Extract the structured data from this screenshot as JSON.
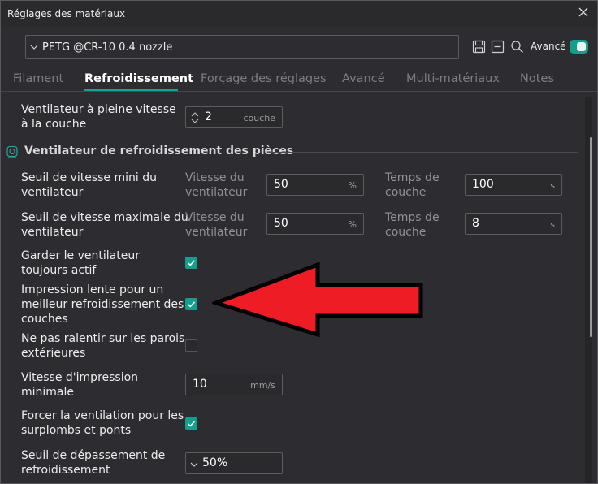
{
  "window": {
    "title": "Réglages des matériaux"
  },
  "preset": {
    "name": "PETG @CR-10 0.4 nozzle",
    "advanced_label": "Avancé",
    "advanced_on": true
  },
  "tabs": [
    {
      "label": "Filament",
      "active": false
    },
    {
      "label": "Refroidissement",
      "active": true
    },
    {
      "label": "Forçage des réglages",
      "active": false
    },
    {
      "label": "Avancé",
      "active": false
    },
    {
      "label": "Multi-matériaux",
      "active": false
    },
    {
      "label": "Notes",
      "active": false
    }
  ],
  "full_fan_layer": {
    "label_l1": "Ventilateur à pleine vitesse",
    "label_l2": "à la couche",
    "value": "2",
    "unit": "couche"
  },
  "section": {
    "title": "Ventilateur de refroidissement des pièces"
  },
  "min_fan": {
    "label_l1": "Seuil de vitesse mini du",
    "label_l2": "ventilateur",
    "speed_l1": "Vitesse du",
    "speed_l2": "ventilateur",
    "speed_value": "50",
    "speed_unit": "%",
    "time_l1": "Temps de",
    "time_l2": "couche",
    "time_value": "100",
    "time_unit": "s"
  },
  "max_fan": {
    "label_l1": "Seuil de vitesse maximale du",
    "label_l2": "ventilateur",
    "speed_l1": "Vitesse du",
    "speed_l2": "ventilateur",
    "speed_value": "50",
    "speed_unit": "%",
    "time_l1": "Temps de",
    "time_l2": "couche",
    "time_value": "8",
    "time_unit": "s"
  },
  "keep_fan": {
    "label_l1": "Garder le ventilateur",
    "label_l2": "toujours actif",
    "checked": true
  },
  "slow_down": {
    "label_l1": "Impression lente pour un",
    "label_l2": "meilleur refroidissement des",
    "label_l3": "couches",
    "checked": true
  },
  "dont_slow_walls": {
    "label_l1": "Ne pas ralentir sur les parois",
    "label_l2": "extérieures",
    "checked": false
  },
  "min_speed": {
    "label_l1": "Vitesse d'impression",
    "label_l2": "minimale",
    "value": "10",
    "unit": "mm/s"
  },
  "force_cooling": {
    "label_l1": "Forcer la ventilation pour les",
    "label_l2": "surplombs et ponts",
    "checked": true
  },
  "overhang_threshold": {
    "label_l1": "Seuil de dépassement de",
    "label_l2": "refroidissement",
    "value": "50%"
  }
}
